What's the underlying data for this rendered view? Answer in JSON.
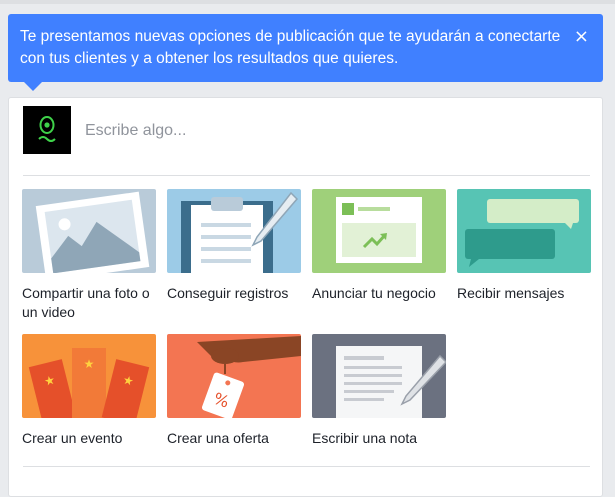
{
  "tooltip": {
    "text": "Te presentamos nuevas opciones de publicación que te ayudarán a conectarte con tus clientes y a obtener los resultados que quieres.",
    "close_icon": "×"
  },
  "composer": {
    "placeholder": "Escribe algo..."
  },
  "options": [
    {
      "label": "Compartir una foto o un video",
      "icon": "photo-icon",
      "color": "#b9cbd9"
    },
    {
      "label": "Conseguir registros",
      "icon": "clipboard-icon",
      "color": "#9ccbe7"
    },
    {
      "label": "Anunciar tu negocio",
      "icon": "ad-icon",
      "color": "#9fd07a"
    },
    {
      "label": "Recibir mensajes",
      "icon": "chat-bubbles-icon",
      "color": "#57c4b4"
    },
    {
      "label": "Crear un evento",
      "icon": "tickets-icon",
      "color": "#f7923a"
    },
    {
      "label": "Crear una oferta",
      "icon": "offer-tag-icon",
      "color": "#f37552"
    },
    {
      "label": "Escribir una nota",
      "icon": "note-icon",
      "color": "#6b7180"
    }
  ],
  "colors": {
    "accent": "#4080ff",
    "background": "#e9ebee"
  }
}
